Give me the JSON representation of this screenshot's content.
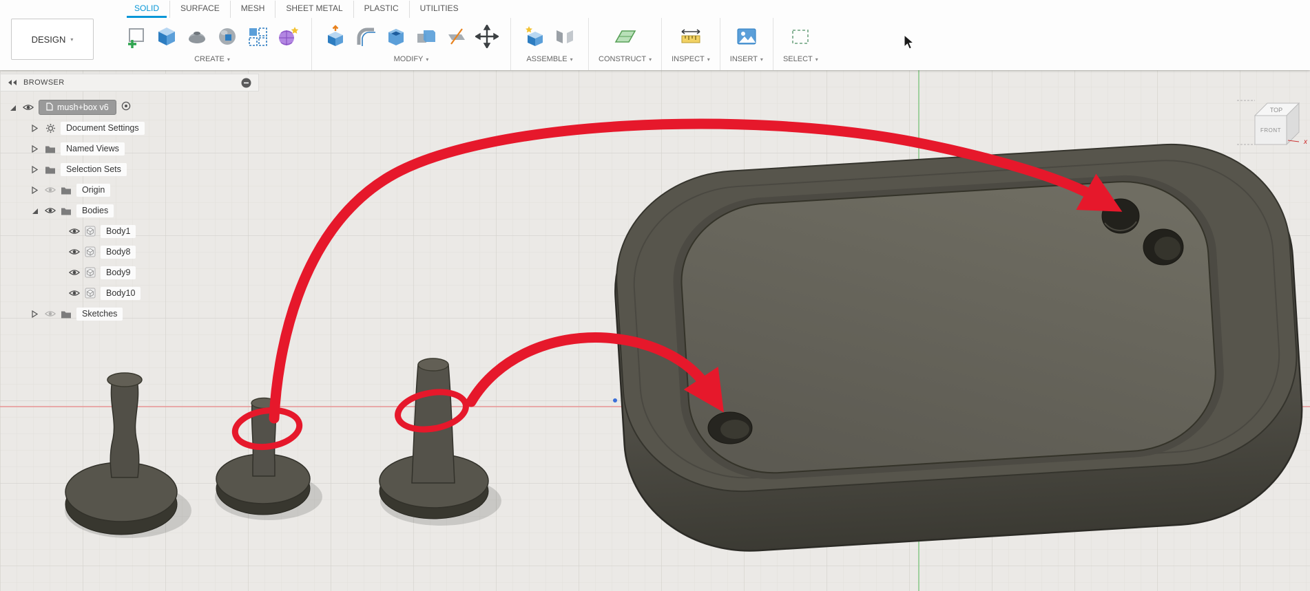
{
  "toolbar": {
    "design_button_label": "DESIGN",
    "caret": "▾",
    "tabs": [
      "SOLID",
      "SURFACE",
      "MESH",
      "SHEET METAL",
      "PLASTIC",
      "UTILITIES"
    ],
    "active_tab": "SOLID",
    "groups": [
      "CREATE",
      "MODIFY",
      "ASSEMBLE",
      "CONSTRUCT",
      "INSPECT",
      "INSERT",
      "SELECT"
    ]
  },
  "browser": {
    "title": "BROWSER",
    "root_label": "mush+box v6",
    "items": [
      {
        "label": "Document Settings"
      },
      {
        "label": "Named Views"
      },
      {
        "label": "Selection Sets"
      },
      {
        "label": "Origin",
        "hidden": true
      },
      {
        "label": "Bodies",
        "expanded": true
      },
      {
        "label": "Body1"
      },
      {
        "label": "Body8"
      },
      {
        "label": "Body9"
      },
      {
        "label": "Body10"
      },
      {
        "label": "Sketches",
        "hidden": true
      }
    ]
  },
  "viewcube": {
    "top_label": "TOP",
    "front_label": "FRONT",
    "x_axis_label": "x"
  },
  "colors": {
    "accent-blue": "#0696d7",
    "annotation-red": "#e6182b",
    "viewport-bg": "#ebe9e6",
    "grid-minor": "#e1dfdb",
    "grid-major": "#d3d1cc",
    "model-dark": "#413f38",
    "model-mid": "#57554c",
    "model-light": "#6b695f",
    "axis-red": "#e89494",
    "axis-green": "#8cc98c"
  }
}
